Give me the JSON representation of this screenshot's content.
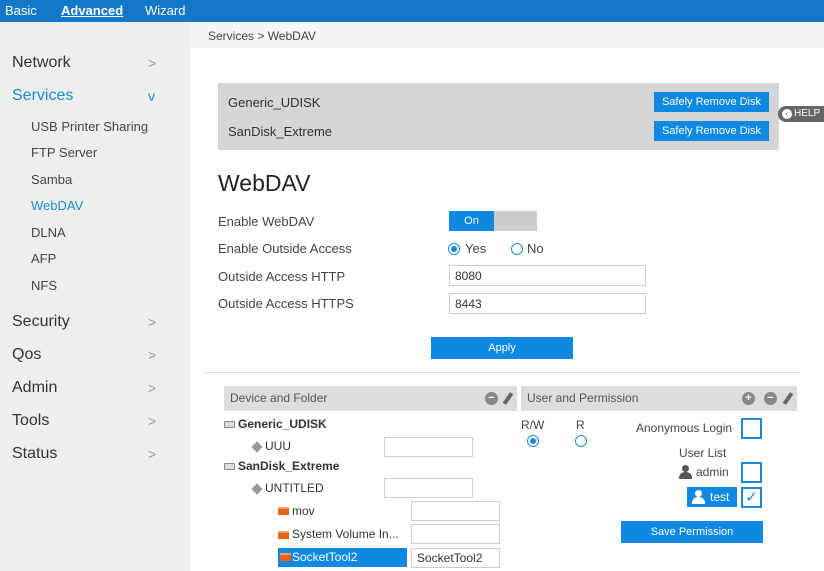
{
  "topnav": {
    "basic": "Basic",
    "advanced": "Advanced",
    "wizard": "Wizard"
  },
  "sidebar": {
    "items": [
      {
        "label": "Network",
        "chevron": ">"
      },
      {
        "label": "Services",
        "chevron": "v",
        "active": true
      },
      {
        "label": "Security",
        "chevron": ">"
      },
      {
        "label": "Qos",
        "chevron": ">"
      },
      {
        "label": "Admin",
        "chevron": ">"
      },
      {
        "label": "Tools",
        "chevron": ">"
      },
      {
        "label": "Status",
        "chevron": ">"
      }
    ],
    "sub_items": [
      "USB Printer Sharing",
      "FTP Server",
      "Samba",
      "WebDAV",
      "DLNA",
      "AFP",
      "NFS"
    ],
    "active_sub": "WebDAV"
  },
  "breadcrumb": "Services > WebDAV",
  "disks": [
    {
      "name": "Generic_UDISK",
      "button": "Safely Remove Disk"
    },
    {
      "name": "SanDisk_Extreme",
      "button": "Safely Remove Disk"
    }
  ],
  "help": "HELP",
  "page_title": "WebDAV",
  "form": {
    "enable_label": "Enable WebDAV",
    "toggle_on": "On",
    "outside_label": "Enable Outside Access",
    "yes": "Yes",
    "no": "No",
    "outside_selected": "Yes",
    "http_label": "Outside Access HTTP",
    "http_value": "8080",
    "https_label": "Outside Access HTTPS",
    "https_value": "8443",
    "apply": "Apply"
  },
  "device_panel": {
    "title": "Device and Folder",
    "tree": {
      "disk1": "Generic_UDISK",
      "vol1": "UUU",
      "disk2": "SanDisk_Extreme",
      "vol2": "UNTITLED",
      "folders": [
        "mov",
        "System Volume In...",
        "SocketTool2"
      ],
      "selected_folder_input": "SocketTool2"
    }
  },
  "user_panel": {
    "title": "User and Permission",
    "rw": "R/W",
    "r": "R",
    "anonymous": "Anonymous Login",
    "user_list": "User List",
    "users": [
      {
        "name": "admin",
        "checked": false
      },
      {
        "name": "test",
        "checked": true
      }
    ],
    "check_mark": "✓",
    "save": "Save Permission"
  },
  "colors": {
    "accent": "#0d88e3",
    "topbar": "#1478c8",
    "sidebar_bg": "#eeeeee"
  }
}
